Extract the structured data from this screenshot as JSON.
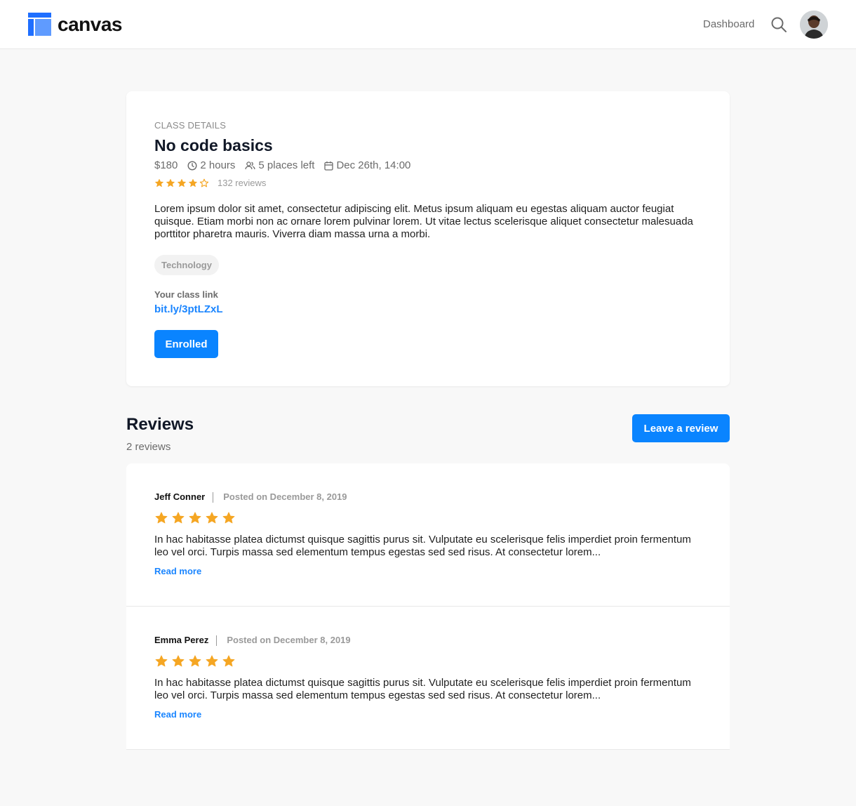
{
  "app": {
    "brand": "canvas",
    "nav_dashboard": "Dashboard",
    "accent_color": "#0a84ff",
    "star_color": "#f5a623",
    "icons": {
      "logo": "canvas-logo-icon",
      "search": "search-icon",
      "avatar": "user-avatar"
    }
  },
  "class": {
    "eyebrow": "CLASS DETAILS",
    "title": "No code basics",
    "price": "$180",
    "duration": "2 hours",
    "places": "5 places left",
    "date": "Dec 26th, 14:00",
    "rating": 4,
    "rating_max": 5,
    "review_count": "132 reviews",
    "description": "Lorem ipsum dolor sit amet, consectetur adipiscing elit. Metus ipsum aliquam eu egestas aliquam auctor feugiat quisque. Etiam morbi non ac ornare lorem pulvinar lorem. Ut vitae lectus scelerisque aliquet consectetur malesuada porttitor pharetra mauris. Viverra diam massa urna a morbi.",
    "tag": "Technology",
    "link_label": "Your class link",
    "link": "bit.ly/3ptLZxL",
    "enrolled_label": "Enrolled"
  },
  "reviews": {
    "title": "Reviews",
    "count": "2 reviews",
    "leave_label": "Leave a review",
    "items": [
      {
        "author": "Jeff Conner",
        "date": "Posted on December 8, 2019",
        "rating": 5,
        "body": "In hac habitasse platea dictumst quisque sagittis purus sit. Vulputate eu scelerisque felis imperdiet proin fermentum leo vel orci. Turpis massa sed elementum tempus egestas sed sed risus. At consectetur lorem...",
        "read_more": "Read more"
      },
      {
        "author": "Emma Perez",
        "date": "Posted on December 8, 2019",
        "rating": 5,
        "body": "In hac habitasse platea dictumst quisque sagittis purus sit. Vulputate eu scelerisque felis imperdiet proin fermentum leo vel orci. Turpis massa sed elementum tempus egestas sed sed risus. At consectetur lorem...",
        "read_more": "Read more"
      }
    ]
  }
}
